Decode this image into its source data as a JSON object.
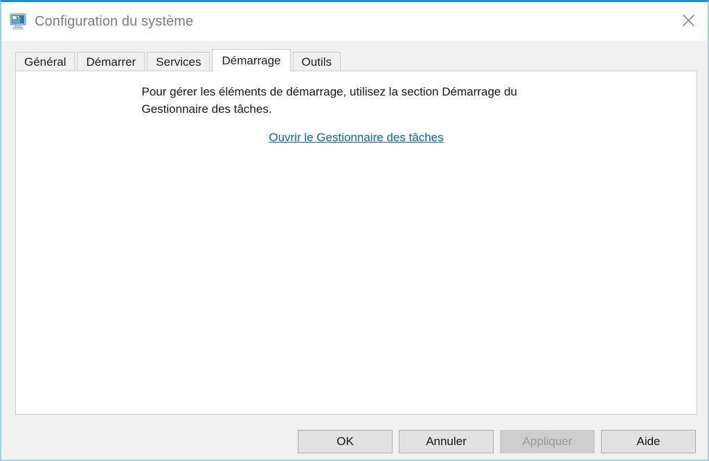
{
  "window": {
    "title": "Configuration du système",
    "icon": "system-configuration-monitor-icon",
    "close_label": "✕",
    "accent_color": "#1b8ed0",
    "border_color": "#9cd0e8"
  },
  "tabs": [
    {
      "label": "Général",
      "selected": false
    },
    {
      "label": "Démarrer",
      "selected": false
    },
    {
      "label": "Services",
      "selected": false
    },
    {
      "label": "Démarrage",
      "selected": true
    },
    {
      "label": "Outils",
      "selected": false
    }
  ],
  "content": {
    "info_text": "Pour gérer les éléments de démarrage, utilisez la section Démarrage du Gestionnaire des tâches.",
    "link_label": "Ouvrir le Gestionnaire des tâches",
    "link_color": "#0a65ad"
  },
  "buttons": [
    {
      "label": "OK",
      "disabled": false
    },
    {
      "label": "Annuler",
      "disabled": false
    },
    {
      "label": "Appliquer",
      "disabled": true
    },
    {
      "label": "Aide",
      "disabled": false
    }
  ]
}
